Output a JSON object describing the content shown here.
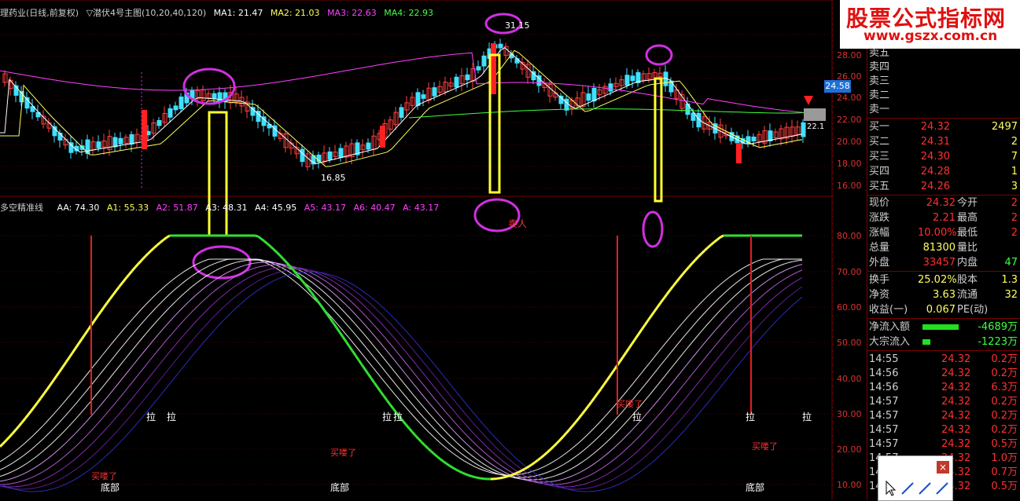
{
  "main_chart": {
    "title": "理药业(日线,前复权)",
    "indicator_name": "▽潜伏4号主图(10,20,40,120)",
    "ma": [
      {
        "label": "MA1: 21.47",
        "color": "#ffffff"
      },
      {
        "label": "MA2: 21.03",
        "color": "#ffff60"
      },
      {
        "label": "MA3: 22.63",
        "color": "#ff40ff"
      },
      {
        "label": "MA4: 22.93",
        "color": "#40ff40"
      }
    ],
    "price_axis": [
      "28.00",
      "26.00",
      "24.00",
      "22.00",
      "20.00",
      "18.00",
      "16.00"
    ],
    "high_label": "31.15",
    "low_label": "16.85",
    "right_label": "22.1",
    "current_price_tag": "24.58"
  },
  "indicator": {
    "name": "多空精准线",
    "values": [
      {
        "label": "AA: 74.30",
        "color": "#ffffff"
      },
      {
        "label": "A1: 55.33",
        "color": "#ffff60"
      },
      {
        "label": "A2: 51.87",
        "color": "#ff40ff"
      },
      {
        "label": "A3: 48.31",
        "color": "#ffffff"
      },
      {
        "label": "A4: 45.95",
        "color": "#ffffff"
      },
      {
        "label": "A5: 43.17",
        "color": "#ff40ff"
      },
      {
        "label": "A6: 40.47",
        "color": "#ff40ff"
      },
      {
        "label": "A: 43.17",
        "color": "#ff40ff"
      }
    ],
    "axis": [
      "80.00",
      "70.00",
      "60.00",
      "50.00",
      "40.00",
      "30.00",
      "20.00",
      "10.00"
    ],
    "labels": {
      "bottom1": "底部",
      "bottom2": "底部",
      "bottom3": "底部",
      "la1": "拉",
      "la2": "拉",
      "la3": "拉",
      "la4": "拉",
      "la5": "拉",
      "la6": "拉",
      "la7": "拉",
      "buy1": "买喽了",
      "buy2": "买喽了",
      "buy3": "买喽了",
      "buy4": "买喽了",
      "sell": "卖人"
    }
  },
  "watermark": {
    "line1": "股票公式指标网",
    "line2": "www.gszx.com.cn"
  },
  "order_book": {
    "sell": [
      {
        "label": "卖五",
        "price": "",
        "vol": ""
      },
      {
        "label": "卖四",
        "price": "",
        "vol": ""
      },
      {
        "label": "卖三",
        "price": "",
        "vol": ""
      },
      {
        "label": "卖二",
        "price": "",
        "vol": ""
      },
      {
        "label": "卖一",
        "price": "",
        "vol": ""
      }
    ],
    "buy": [
      {
        "label": "买一",
        "price": "24.32",
        "vol": "2497"
      },
      {
        "label": "买二",
        "price": "24.31",
        "vol": "2"
      },
      {
        "label": "买三",
        "price": "24.30",
        "vol": "7"
      },
      {
        "label": "买四",
        "price": "24.28",
        "vol": "1"
      },
      {
        "label": "买五",
        "price": "24.26",
        "vol": "3"
      }
    ]
  },
  "quote": [
    {
      "l1": "现价",
      "v1": "24.32",
      "l2": "今开",
      "v2": "2"
    },
    {
      "l1": "涨跌",
      "v1": "2.21",
      "l2": "最高",
      "v2": "2"
    },
    {
      "l1": "涨幅",
      "v1": "10.00%",
      "l2": "最低",
      "v2": "2"
    },
    {
      "l1": "总量",
      "v1": "81300",
      "l2": "量比",
      "v2": ""
    },
    {
      "l1": "外盘",
      "v1": "33457",
      "l2": "内盘",
      "v2": "47"
    }
  ],
  "stats": [
    {
      "l1": "换手",
      "v1": "25.02%",
      "l2": "股本",
      "v2": "1.3"
    },
    {
      "l1": "净资",
      "v1": "3.63",
      "l2": "流通",
      "v2": "32"
    },
    {
      "l1": "收益(一)",
      "v1": "0.067",
      "l2": "PE(动)",
      "v2": ""
    }
  ],
  "flows": [
    {
      "label": "净流入额",
      "value": "-4689万"
    },
    {
      "label": "大宗流入",
      "value": "-1223万"
    }
  ],
  "trades": [
    {
      "time": "14:55",
      "price": "24.32",
      "vol": "0.2万"
    },
    {
      "time": "14:56",
      "price": "24.32",
      "vol": "0.2万"
    },
    {
      "time": "14:56",
      "price": "24.32",
      "vol": "6.3万"
    },
    {
      "time": "14:57",
      "price": "24.32",
      "vol": "0.2万"
    },
    {
      "time": "14:57",
      "price": "24.32",
      "vol": "0.2万"
    },
    {
      "time": "14:57",
      "price": "24.32",
      "vol": "0.2万"
    },
    {
      "time": "14:57",
      "price": "24.32",
      "vol": "0.5万"
    },
    {
      "time": "14:57",
      "price": "24.32",
      "vol": "1.0万"
    },
    {
      "time": "14:57",
      "price": "24.32",
      "vol": "0.7万"
    },
    {
      "time": "14:57",
      "price": "24.32",
      "vol": "0.5万"
    }
  ]
}
